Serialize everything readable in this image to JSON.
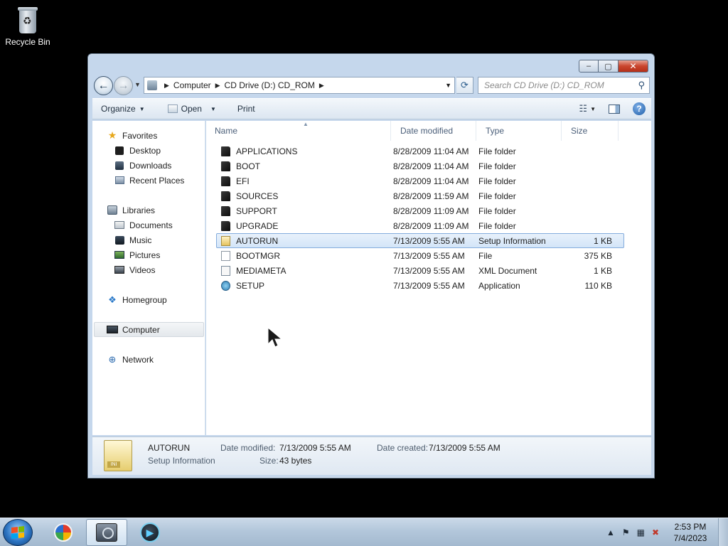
{
  "desktop": {
    "recycle_bin_label": "Recycle Bin"
  },
  "window": {
    "controls": {
      "minimize": "–",
      "maximize": "▢",
      "close": "✕"
    },
    "nav": {
      "back_glyph": "←",
      "forward_glyph": "→",
      "breadcrumb": [
        "Computer",
        "CD Drive (D:) CD_ROM"
      ],
      "search_placeholder": "Search CD Drive (D:) CD_ROM"
    },
    "toolbar": {
      "organize": "Organize",
      "open": "Open",
      "print": "Print"
    },
    "nav_pane": {
      "favorites": "Favorites",
      "desktop": "Desktop",
      "downloads": "Downloads",
      "recent_places": "Recent Places",
      "libraries": "Libraries",
      "documents": "Documents",
      "music": "Music",
      "pictures": "Pictures",
      "videos": "Videos",
      "homegroup": "Homegroup",
      "computer": "Computer",
      "network": "Network"
    },
    "columns": {
      "name": "Name",
      "date_modified": "Date modified",
      "type": "Type",
      "size": "Size"
    },
    "files": [
      {
        "name": "APPLICATIONS",
        "date": "8/28/2009 11:04 AM",
        "type": "File folder",
        "size": "",
        "icon": "folder-icon"
      },
      {
        "name": "BOOT",
        "date": "8/28/2009 11:04 AM",
        "type": "File folder",
        "size": "",
        "icon": "folder-icon"
      },
      {
        "name": "EFI",
        "date": "8/28/2009 11:04 AM",
        "type": "File folder",
        "size": "",
        "icon": "folder-icon"
      },
      {
        "name": "SOURCES",
        "date": "8/28/2009 11:59 AM",
        "type": "File folder",
        "size": "",
        "icon": "folder-icon"
      },
      {
        "name": "SUPPORT",
        "date": "8/28/2009 11:09 AM",
        "type": "File folder",
        "size": "",
        "icon": "folder-icon"
      },
      {
        "name": "UPGRADE",
        "date": "8/28/2009 11:09 AM",
        "type": "File folder",
        "size": "",
        "icon": "folder-icon"
      },
      {
        "name": "AUTORUN",
        "date": "7/13/2009 5:55 AM",
        "type": "Setup Information",
        "size": "1 KB",
        "icon": "setup-info-icon",
        "selected": true
      },
      {
        "name": "BOOTMGR",
        "date": "7/13/2009 5:55 AM",
        "type": "File",
        "size": "375 KB",
        "icon": "file-icon"
      },
      {
        "name": "MEDIAMETA",
        "date": "7/13/2009 5:55 AM",
        "type": "XML Document",
        "size": "1 KB",
        "icon": "xml-icon"
      },
      {
        "name": "SETUP",
        "date": "7/13/2009 5:55 AM",
        "type": "Application",
        "size": "110 KB",
        "icon": "application-icon"
      }
    ],
    "details": {
      "name": "AUTORUN",
      "type": "Setup Information",
      "date_modified_label": "Date modified:",
      "date_modified": "7/13/2009 5:55 AM",
      "date_created_label": "Date created:",
      "date_created": "7/13/2009 5:55 AM",
      "size_label": "Size:",
      "size": "43 bytes",
      "icon_badge": "INI"
    }
  },
  "taskbar": {
    "clock_time": "2:53 PM",
    "clock_date": "7/4/2023",
    "accent": "#2c74c2"
  }
}
